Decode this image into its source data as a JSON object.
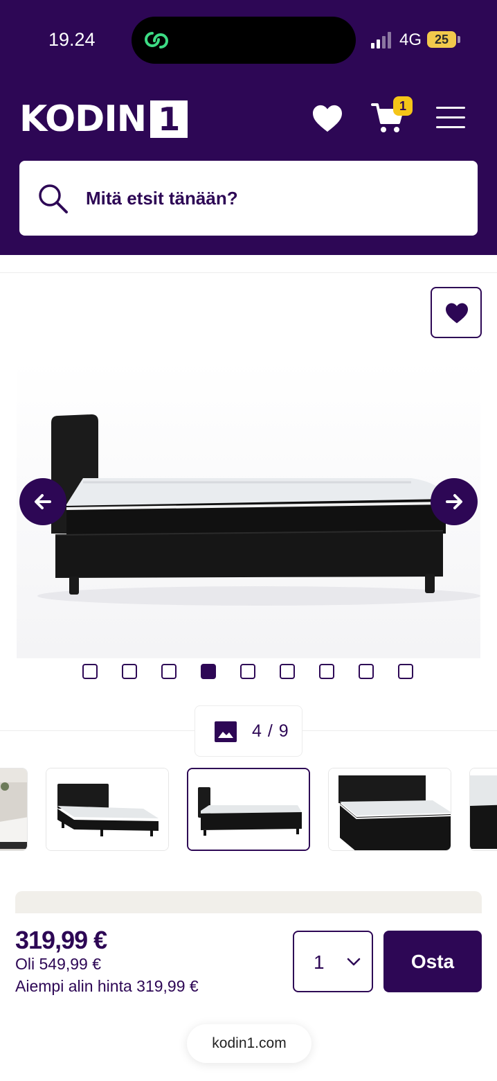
{
  "status_bar": {
    "time": "19.24",
    "network": "4G",
    "battery": "25",
    "icons": [
      "live-activity-icon",
      "signal-icon",
      "battery-icon"
    ]
  },
  "header": {
    "logo_text": "KODIN",
    "logo_number": "1",
    "cart_count": "1",
    "icons": [
      "heart-icon",
      "cart-icon",
      "menu-icon"
    ],
    "brand_color": "#2d0755",
    "badge_color": "#f5c518"
  },
  "search": {
    "placeholder": "Mitä etsit tänään?",
    "icon": "search-icon"
  },
  "gallery": {
    "current_index": 4,
    "total_images": 9,
    "counter_text": "4 / 9",
    "dots_count": 9,
    "icons": [
      "favorite-heart-icon",
      "arrow-left-icon",
      "arrow-right-icon",
      "image-icon"
    ]
  },
  "buy_bar": {
    "price": "319,99 €",
    "was_price": "Oli 549,99 €",
    "lowest_price": "Aiempi alin hinta 319,99 €",
    "quantity": "1",
    "buy_label": "Osta",
    "icons": [
      "chevron-down-icon"
    ]
  },
  "browser": {
    "url": "kodin1.com"
  }
}
